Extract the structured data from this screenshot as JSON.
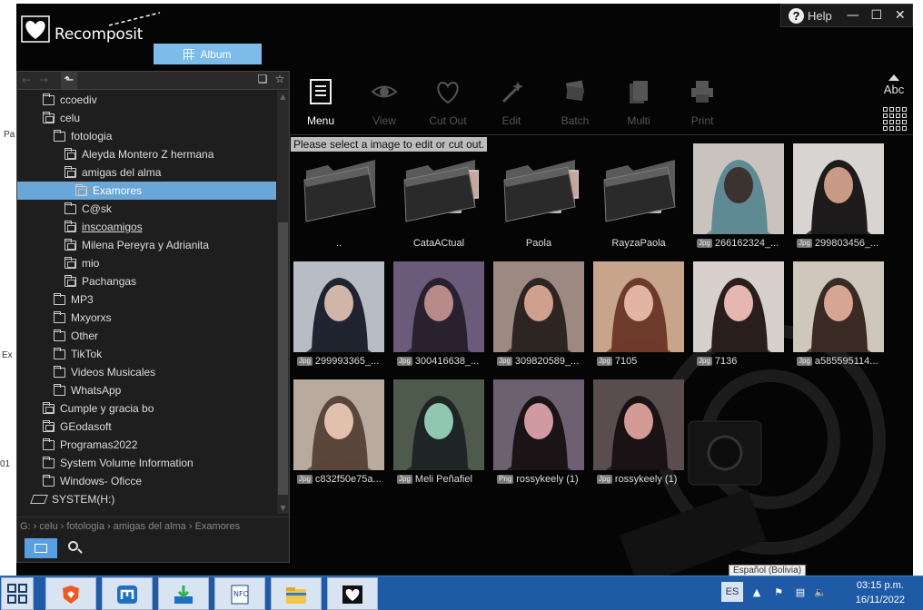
{
  "app": {
    "name": "Recomposit",
    "help_label": "Help",
    "album_tab": "Album"
  },
  "window_controls": [
    "minimize",
    "maximize",
    "close"
  ],
  "toolbar": [
    {
      "label": "Menu",
      "icon": "menu-icon",
      "state": "active"
    },
    {
      "label": "View",
      "icon": "eye-icon",
      "state": "disabled"
    },
    {
      "label": "Cut Out",
      "icon": "heart-cutout-icon",
      "state": "disabled"
    },
    {
      "label": "Edit",
      "icon": "edit-wand-icon",
      "state": "disabled"
    },
    {
      "label": "Batch",
      "icon": "batch-icon",
      "state": "disabled"
    },
    {
      "label": "Multi",
      "icon": "multi-icon",
      "state": "disabled"
    },
    {
      "label": "Print",
      "icon": "printer-icon",
      "state": "disabled"
    }
  ],
  "sort_label": "Abc",
  "hint": "Please select a image to edit or cut out.",
  "tree": [
    {
      "label": "ccoediv",
      "type": "folder",
      "indent": 1
    },
    {
      "label": "celu",
      "type": "folder-img",
      "indent": 1
    },
    {
      "label": "fotologia",
      "type": "folder",
      "indent": 2
    },
    {
      "label": "Aleyda Montero Z hermana",
      "type": "folder-img",
      "indent": 3
    },
    {
      "label": "amigas del alma",
      "type": "folder-img",
      "indent": 3
    },
    {
      "label": "Examores",
      "type": "folder-img",
      "indent": 4,
      "selected": true
    },
    {
      "label": "C@sk",
      "type": "folder",
      "indent": 3
    },
    {
      "label": "inscoamigos",
      "type": "folder-img",
      "indent": 3,
      "underline": true
    },
    {
      "label": "Milena Pereyra y Adrianita",
      "type": "folder-img",
      "indent": 3
    },
    {
      "label": "mio",
      "type": "folder-img",
      "indent": 3
    },
    {
      "label": "Pachangas",
      "type": "folder-img",
      "indent": 3
    },
    {
      "label": "MP3",
      "type": "folder",
      "indent": 2
    },
    {
      "label": "Mxyorxs",
      "type": "folder",
      "indent": 2
    },
    {
      "label": "Other",
      "type": "folder",
      "indent": 2
    },
    {
      "label": "TikTok",
      "type": "folder",
      "indent": 2
    },
    {
      "label": "Videos Musicales",
      "type": "folder",
      "indent": 2
    },
    {
      "label": "WhatsApp",
      "type": "folder",
      "indent": 2
    },
    {
      "label": "Cumple y gracia bo",
      "type": "folder-img",
      "indent": 1
    },
    {
      "label": "GEodasoft",
      "type": "folder-img",
      "indent": 1
    },
    {
      "label": "Programas2022",
      "type": "folder",
      "indent": 1
    },
    {
      "label": "System Volume Information",
      "type": "folder",
      "indent": 1
    },
    {
      "label": "Windows-  Oficce",
      "type": "folder",
      "indent": 1
    },
    {
      "label": "SYSTEM(H:)",
      "type": "drive",
      "indent": 0
    }
  ],
  "path": "G: › celu › fotologia › amigas del alma › Examores",
  "items": [
    {
      "name": "..",
      "kind": "folder",
      "thumbs": 0
    },
    {
      "name": "CataACtual",
      "kind": "folder",
      "thumbs": 3
    },
    {
      "name": "Paola",
      "kind": "folder",
      "thumbs": 3
    },
    {
      "name": "RayzaPaola",
      "kind": "folder",
      "thumbs": 2
    },
    {
      "name": "266162324_...",
      "kind": "image",
      "badge": "Jpg",
      "tone": [
        "#c9c2bd",
        "#5f8a94",
        "#3b3330"
      ]
    },
    {
      "name": "299803456_...",
      "kind": "image",
      "badge": "Jpg",
      "tone": [
        "#d7d4d2",
        "#1d1b1c",
        "#c99a86"
      ]
    },
    {
      "name": "299993365_...",
      "kind": "image",
      "badge": "Jpg",
      "tone": [
        "#b8bcc4",
        "#1f2430",
        "#d1b5a8"
      ]
    },
    {
      "name": "300416638_...",
      "kind": "image",
      "badge": "Jpg",
      "tone": [
        "#6b5a7a",
        "#2a2130",
        "#b98a8a"
      ]
    },
    {
      "name": "309820589_...",
      "kind": "image",
      "badge": "Jpg",
      "tone": [
        "#9c8a82",
        "#2d2522",
        "#d0a08e"
      ]
    },
    {
      "name": "7105",
      "kind": "image",
      "badge": "Jpg",
      "tone": [
        "#c8a58a",
        "#6e3a2a",
        "#e0b5a3"
      ]
    },
    {
      "name": "7136",
      "kind": "image",
      "badge": "Jpg",
      "tone": [
        "#d8d0cc",
        "#2a1e1c",
        "#e5b7b0"
      ]
    },
    {
      "name": "a585595114...",
      "kind": "image",
      "badge": "Jpg",
      "tone": [
        "#cfc6bc",
        "#3a2a24",
        "#d7a693"
      ]
    },
    {
      "name": "c832f50e75a...",
      "kind": "image",
      "badge": "Jpg",
      "tone": [
        "#b9aaa0",
        "#5a463a",
        "#e1c1ad"
      ]
    },
    {
      "name": "Meli Peñafiel",
      "kind": "image",
      "badge": "Jpg",
      "tone": [
        "#4d5a4c",
        "#1f2424",
        "#8fc7b1"
      ]
    },
    {
      "name": "rossykeely (1)",
      "kind": "image",
      "badge": "Png",
      "tone": [
        "#6d6070",
        "#1a1416",
        "#d09aa0"
      ]
    },
    {
      "name": "rossykeely (1)",
      "kind": "image",
      "badge": "Jpg",
      "tone": [
        "#5a4d50",
        "#1a1214",
        "#d39a96"
      ]
    }
  ],
  "taskbar": {
    "apps": [
      "brave-icon",
      "maxthon-icon",
      "downloader-icon",
      "nfo-viewer-icon",
      "file-explorer-icon",
      "recomposit-icon"
    ],
    "language": "ES",
    "language_tooltip": "Español (Bolivia)",
    "time": "03:15 p.m.",
    "date": "16/11/2022"
  },
  "colors": {
    "accent": "#7dbbea",
    "selection": "#6aa6d6",
    "taskbar": "#1f5aa6"
  }
}
